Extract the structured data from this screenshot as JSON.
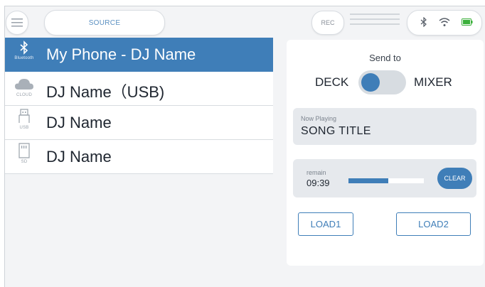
{
  "topbar": {
    "source_label": "SOURCE",
    "rec_label": "REC"
  },
  "sources": [
    {
      "name": "My Phone - DJ Name",
      "caption": "Bluetooth",
      "icon": "bluetooth-icon",
      "selected": true
    },
    {
      "name": "DJ Name（USB)",
      "caption": "CLOUD",
      "icon": "cloud-icon",
      "selected": false
    },
    {
      "name": "DJ Name",
      "caption": "USB",
      "icon": "usb-icon",
      "selected": false
    },
    {
      "name": "DJ Name",
      "caption": "SD",
      "icon": "sd-card-icon",
      "selected": false
    }
  ],
  "panel": {
    "send_to_label": "Send to",
    "deck_label": "DECK",
    "mixer_label": "MIXER",
    "now_playing_label": "Now Playing",
    "song_title": "SONG TITLE",
    "remain_label": "remain",
    "remain_time": "09:39",
    "progress_fraction": 0.53,
    "clear_label": "CLEAR",
    "load1_label": "LOAD1",
    "load2_label": "LOAD2"
  },
  "colors": {
    "accent": "#3f7eb8",
    "panel_bg": "#e6e9ed"
  }
}
